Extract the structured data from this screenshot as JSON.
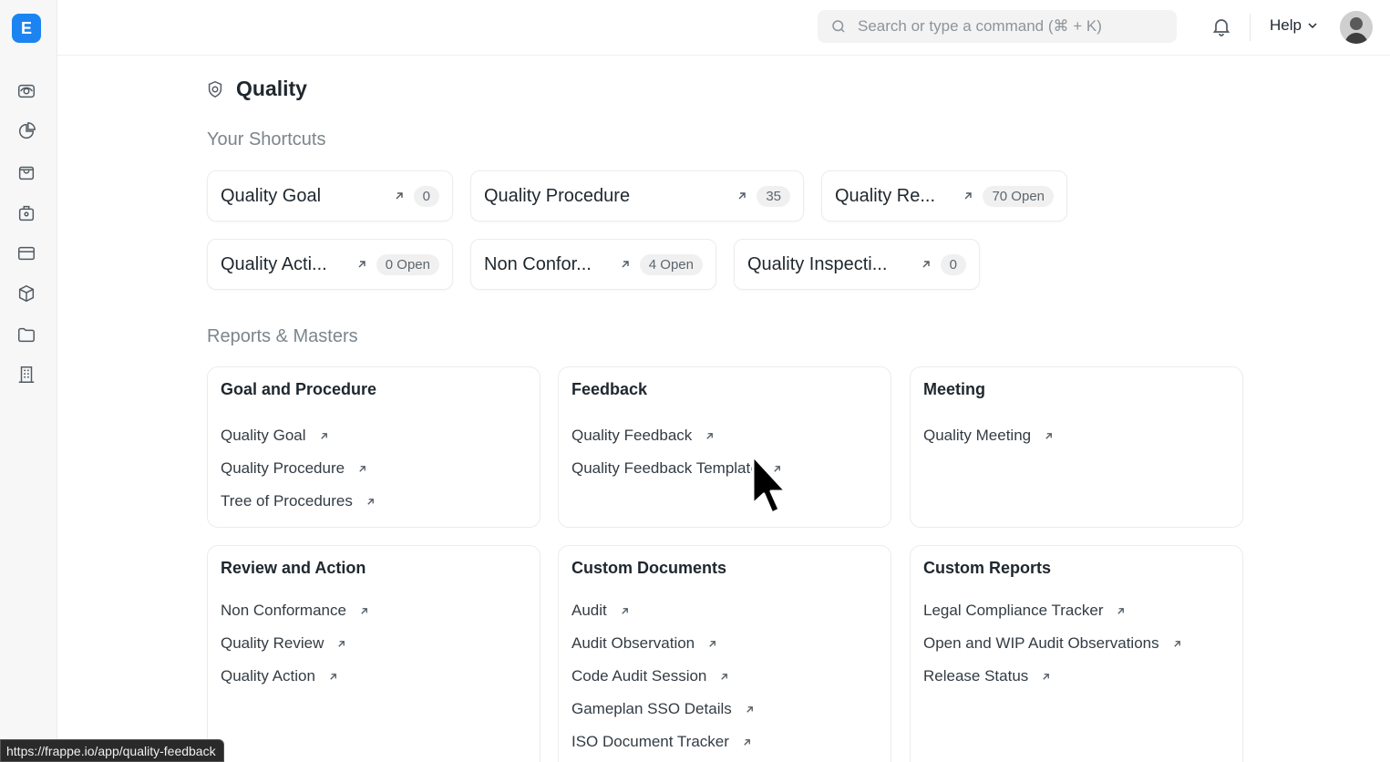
{
  "app": {
    "logo_letter": "E"
  },
  "sidebar": {
    "icons": [
      "eye-icon",
      "pie-chart-icon",
      "shopping-bag-icon",
      "briefcase-icon",
      "credit-card-icon",
      "package-icon",
      "folder-icon",
      "building-icon"
    ]
  },
  "topbar": {
    "search_placeholder": "Search or type a command (⌘ + K)",
    "help_label": "Help"
  },
  "page": {
    "title": "Quality",
    "shortcuts_heading": "Your Shortcuts",
    "reports_heading": "Reports & Masters"
  },
  "shortcuts": [
    {
      "label": "Quality Goal",
      "badge": "0"
    },
    {
      "label": "Quality Procedure",
      "badge": "35"
    },
    {
      "label": "Quality Re...",
      "badge": "70 Open"
    },
    {
      "label": "Quality Acti...",
      "badge": "0 Open"
    },
    {
      "label": "Non Confor...",
      "badge": "4 Open"
    },
    {
      "label": "Quality Inspecti...",
      "badge": "0"
    }
  ],
  "cards": [
    {
      "title": "Goal and Procedure",
      "links": [
        "Quality Goal",
        "Quality Procedure",
        "Tree of Procedures"
      ]
    },
    {
      "title": "Feedback",
      "links": [
        "Quality Feedback",
        "Quality Feedback Template"
      ]
    },
    {
      "title": "Meeting",
      "links": [
        "Quality Meeting"
      ]
    },
    {
      "title": "Review and Action",
      "links": [
        "Non Conformance",
        "Quality Review",
        "Quality Action"
      ]
    },
    {
      "title": "Custom Documents",
      "links": [
        "Audit",
        "Audit Observation",
        "Code Audit Session",
        "Gameplan SSO Details",
        "ISO Document Tracker"
      ]
    },
    {
      "title": "Custom Reports",
      "links": [
        "Legal Compliance Tracker",
        "Open and WIP Audit Observations",
        "Release Status"
      ]
    }
  ],
  "status_url": "https://frappe.io/app/quality-feedback",
  "colors": {
    "accent": "#1c84f0",
    "badge_bg": "#f0f0f0",
    "muted_text": "#7c858c"
  }
}
